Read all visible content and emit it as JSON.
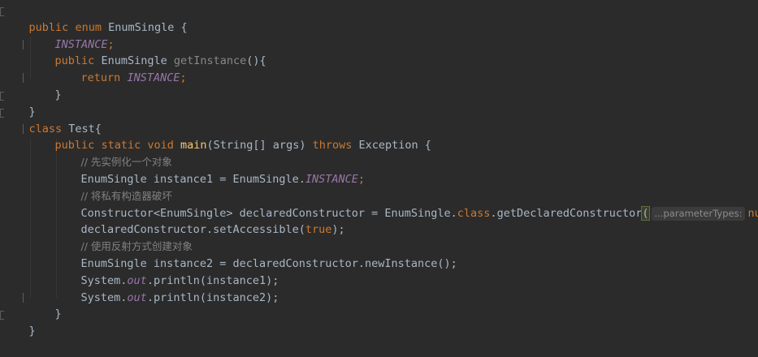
{
  "editor": {
    "lines": {
      "l1": {
        "kw1": "public",
        "kw2": "enum",
        "name": "EnumSingle",
        "rest": " {"
      },
      "l2": {
        "field": "INSTANCE",
        "punct": ";"
      },
      "l3": {
        "kw": "public",
        "type": "EnumSingle",
        "method": "getInstance",
        "rest": "(){"
      },
      "l4": {
        "kw": "return",
        "field": "INSTANCE",
        "punct": ";"
      },
      "l5": {
        "text": "}"
      },
      "l6": {
        "text": "}"
      },
      "l7": {
        "kw": "class",
        "name": "Test{"
      },
      "l8": {
        "kw1": "public",
        "kw2": "static",
        "kw3": "void",
        "method": "main",
        "params": "(String[] args) ",
        "kw4": "throws",
        "rest": " Exception {"
      },
      "l9": {
        "comment": "// 先实例化一个对象"
      },
      "l10": {
        "pre": "EnumSingle instance1 = EnumSingle.",
        "field": "INSTANCE",
        "punct": ";"
      },
      "l11": {
        "comment": "// 将私有构造器破坏"
      },
      "l12": {
        "pre": "Constructor<EnumSingle> declaredConstructor = EnumSingle.",
        "kw": "class",
        "mid": ".getDeclaredConstructor",
        "open": "(",
        "hint": "...parameterTypes:",
        "null": "null",
        "close": ");"
      },
      "l13": {
        "pre": "declaredConstructor.setAccessible(",
        "kw": "true",
        "close": ");"
      },
      "l14": {
        "comment": "// 使用反射方式创建对象"
      },
      "l15": {
        "text": "EnumSingle instance2 = declaredConstructor.newInstance();"
      },
      "l16": {
        "pre": "System.",
        "field": "out",
        "post": ".println(instance1);"
      },
      "l17": {
        "pre": "System.",
        "field": "out",
        "post": ".println(instance2);"
      },
      "l18": {
        "text": "}"
      },
      "l19": {
        "text": "}"
      }
    }
  },
  "colors": {
    "background": "#2b2b2b",
    "keyword": "#cc7832",
    "method": "#ffc66d",
    "field": "#9876aa",
    "comment": "#808080",
    "identifier": "#a9b7c6"
  }
}
